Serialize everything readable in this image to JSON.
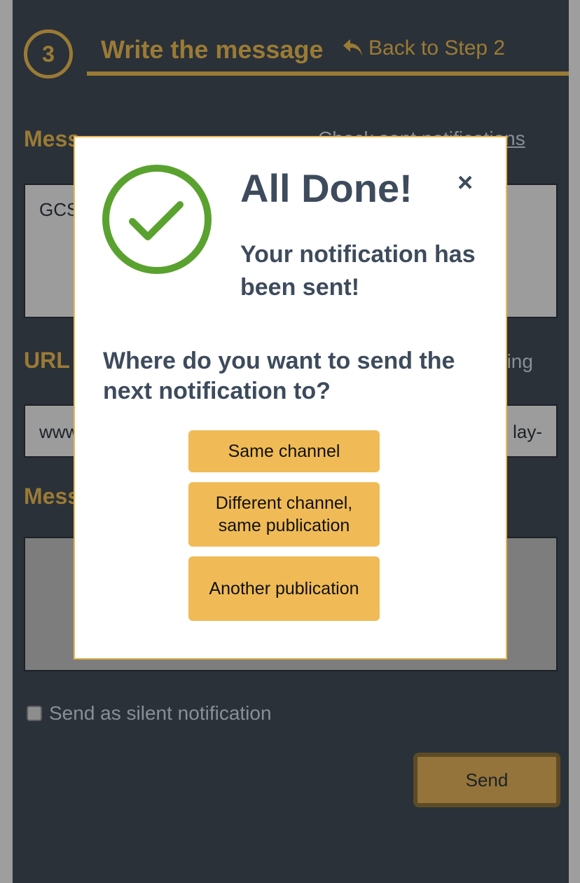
{
  "step": {
    "number": "3",
    "title": "Write the message",
    "back_label": "Back to Step 2"
  },
  "form": {
    "message_label": "Mess",
    "check_link": "Check sent notifications",
    "message_value": "GCS",
    "url_label": "URL",
    "warning_text": "ning",
    "url_value_start": "www",
    "url_value_end": "lay-",
    "message2_label": "Mess",
    "silent_label": "Send as silent notification",
    "send_label": "Send"
  },
  "modal": {
    "title": "All Done!",
    "close_symbol": "×",
    "subtitle": "Your notification has been sent!",
    "question": "Where do you want to send the next notification to?",
    "buttons": {
      "same_channel": "Same channel",
      "different_channel": "Different channel, same publication",
      "another_publication": "Another publication"
    }
  },
  "colors": {
    "accent": "#9a7b35",
    "background": "#2b3139",
    "modal_text": "#3d4b5c",
    "success": "#5aa22f",
    "button": "#f0bb56"
  }
}
